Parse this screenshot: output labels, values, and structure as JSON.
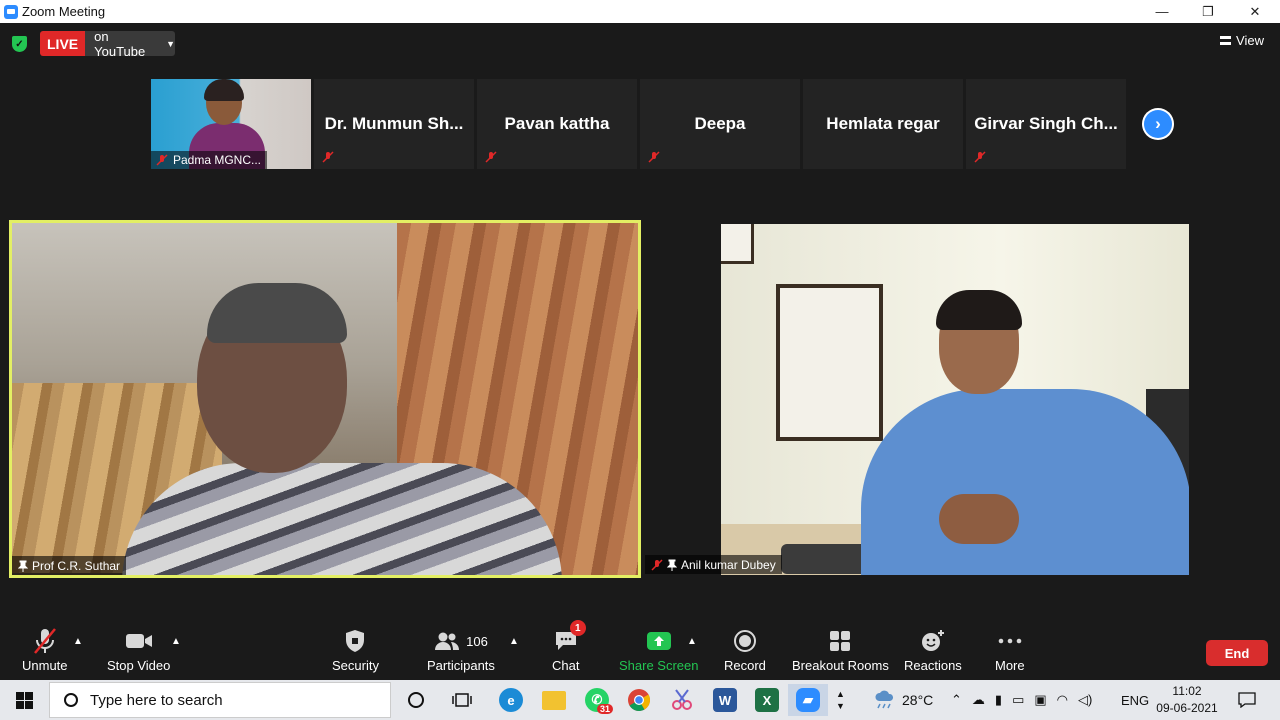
{
  "window": {
    "title": "Zoom Meeting",
    "minimize": "—",
    "restore": "❐",
    "close": "✕"
  },
  "header": {
    "live_label": "LIVE",
    "live_destination": "on YouTube",
    "view_label": "View"
  },
  "gallery_strip": {
    "video_tile_name": "Padma MGNC...",
    "participants": [
      "Dr. Munmun Sh...",
      "Pavan kattha",
      "Deepa",
      "Hemlata regar",
      "Girvar Singh Ch..."
    ],
    "next_arrow": "›"
  },
  "main_videos": [
    {
      "name": "Prof C.R. Suthar",
      "active_speaker": true
    },
    {
      "name": "Anil kumar Dubey",
      "active_speaker": false
    }
  ],
  "toolbar": {
    "unmute": "Unmute",
    "stop_video": "Stop Video",
    "security": "Security",
    "participants_count": "106",
    "participants": "Participants",
    "chat": "Chat",
    "chat_badge": "1",
    "share_screen": "Share Screen",
    "record": "Record",
    "breakout_rooms": "Breakout Rooms",
    "reactions": "Reactions",
    "more": "More",
    "end": "End"
  },
  "colors": {
    "accent": "#2d8cff",
    "live_red": "#e02828",
    "active_border": "#e3ef64",
    "share_green": "#23c552",
    "end_red": "#d92d2d"
  },
  "taskbar": {
    "search_placeholder": "Type here to search",
    "whatsapp_badge": "31",
    "temperature": "28°C",
    "language": "ENG",
    "time": "11:02",
    "date": "09-06-2021"
  }
}
